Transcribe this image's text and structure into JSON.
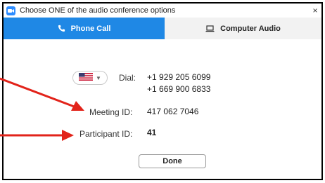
{
  "window": {
    "title": "Choose ONE of the audio conference options",
    "close_glyph": "×"
  },
  "tabs": [
    {
      "label": "Phone Call",
      "icon": "phone-icon",
      "active": true
    },
    {
      "label": "Computer Audio",
      "icon": "laptop-icon",
      "active": false
    }
  ],
  "dial": {
    "country_flag": "us-flag-icon",
    "label": "Dial:",
    "numbers": [
      "+1 929 205 6099",
      "+1 669 900 6833"
    ]
  },
  "meeting": {
    "label": "Meeting ID:",
    "value": "417 062 7046"
  },
  "participant": {
    "label": "Participant ID:",
    "value": "41"
  },
  "done_label": "Done",
  "colors": {
    "accent": "#1f88e5",
    "annotation_arrow": "#e2231a"
  }
}
